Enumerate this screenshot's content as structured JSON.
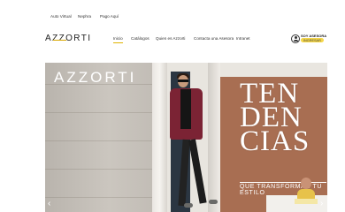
{
  "topbar": {
    "links": [
      "Auto Virtual",
      "Nephra",
      "Pago Aquí"
    ]
  },
  "header": {
    "logo": "AZZORTI",
    "nav": [
      "Inicio",
      "Catálogos",
      "Quien es Azzorti",
      "Contacta una Asesora",
      "Intranet"
    ],
    "active_nav": "Inicio",
    "account_title": "SOY ASESORA",
    "account_action": "INGRESAR",
    "accent_color": "#e0b400"
  },
  "hero": {
    "brand": "AZZORTI",
    "headline_lines": [
      "TEN",
      "DEN",
      "CIAS"
    ],
    "tagline": "QUE TRANSFORMAN TU ESTILO",
    "prev_arrow": "‹",
    "next_arrow": "›"
  }
}
